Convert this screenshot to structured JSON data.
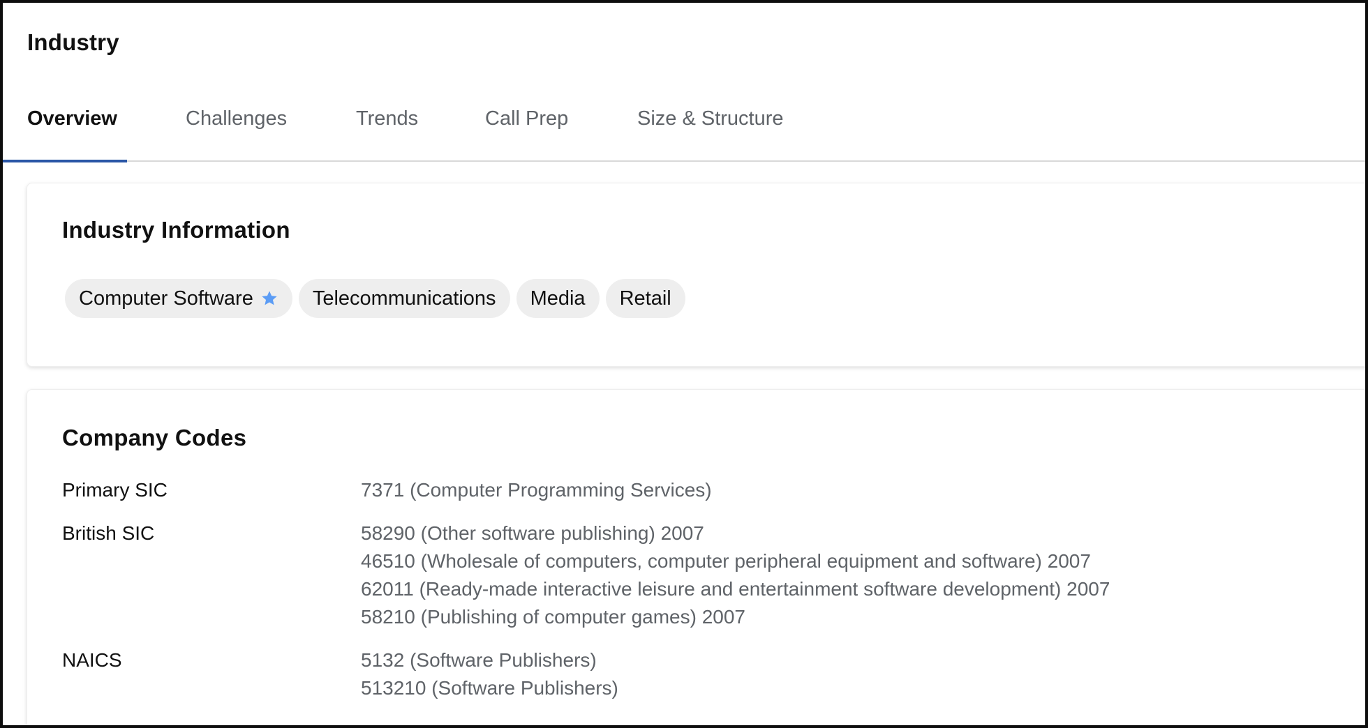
{
  "page": {
    "title": "Industry"
  },
  "tabs": [
    {
      "label": "Overview",
      "active": true
    },
    {
      "label": "Challenges",
      "active": false
    },
    {
      "label": "Trends",
      "active": false
    },
    {
      "label": "Call Prep",
      "active": false
    },
    {
      "label": "Size & Structure",
      "active": false
    }
  ],
  "industry_info": {
    "title": "Industry Information",
    "chips": [
      {
        "label": "Computer Software",
        "icon": "star-icon",
        "primary": true
      },
      {
        "label": "Telecommunications"
      },
      {
        "label": "Media"
      },
      {
        "label": "Retail"
      }
    ]
  },
  "company_codes": {
    "title": "Company Codes",
    "rows": [
      {
        "label": "Primary SIC",
        "values": [
          "7371 (Computer Programming Services)"
        ]
      },
      {
        "label": "British SIC",
        "values": [
          "58290 (Other software publishing) 2007",
          "46510 (Wholesale of computers, computer peripheral equipment and software) 2007",
          "62011 (Ready-made interactive leisure and entertainment software development) 2007",
          "58210 (Publishing of computer games) 2007"
        ]
      },
      {
        "label": "NAICS",
        "values": [
          "5132 (Software Publishers)",
          "513210 (Software Publishers)"
        ]
      }
    ]
  },
  "colors": {
    "accent": "#2a56a6",
    "star": "#5b9cf5",
    "chip_bg": "#eeeeee",
    "secondary_text": "#5f6368"
  }
}
